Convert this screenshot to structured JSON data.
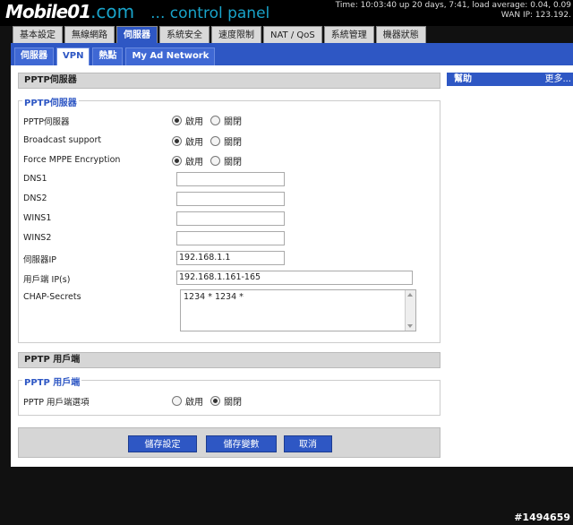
{
  "header": {
    "logo_brand": "Mobile01",
    "logo_tld": ".com",
    "logo_panel": "... control panel",
    "sysinfo_line1": "Time: 10:03:40 up 20 days, 7:41, load average: 0.04, 0.09",
    "sysinfo_line2": "WAN IP: 123.192."
  },
  "main_tabs": [
    "基本設定",
    "無線網路",
    "伺服器",
    "系統安全",
    "速度限制",
    "NAT / QoS",
    "系統管理",
    "機器狀態"
  ],
  "main_tab_active": "伺服器",
  "sub_tabs": [
    "伺服器",
    "VPN",
    "熱點",
    "My Ad Network"
  ],
  "sub_tab_active": "VPN",
  "pptp_server": {
    "section_title": "PPTP伺服器",
    "legend": "PPTP伺服器",
    "enable_label": "PPTP伺服器",
    "broadcast_label": "Broadcast support",
    "mppe_label": "Force MPPE Encryption",
    "on_label": "啟用",
    "off_label": "關閉",
    "dns1_label": "DNS1",
    "dns1_value": "",
    "dns2_label": "DNS2",
    "dns2_value": "",
    "wins1_label": "WINS1",
    "wins1_value": "",
    "wins2_label": "WINS2",
    "wins2_value": "",
    "server_ip_label": "伺服器IP",
    "server_ip_value": "192.168.1.1",
    "client_ip_label": "用戶端 IP(s)",
    "client_ip_value": "192.168.1.161-165",
    "chap_label": "CHAP-Secrets",
    "chap_value": "1234 * 1234 *"
  },
  "pptp_client": {
    "section_title": "PPTP 用戶端",
    "legend": "PPTP 用戶端",
    "option_label": "PPTP 用戶端選項",
    "on_label": "啟用",
    "off_label": "關閉"
  },
  "buttons": {
    "save": "儲存設定",
    "apply": "儲存變數",
    "cancel": "取消"
  },
  "help": {
    "title": "幫助",
    "more": "更多..."
  },
  "watermark": "#1494659",
  "colors": {
    "accent": "#2e57c4",
    "panel_gray": "#d6d6d6",
    "logo_cyan": "#19a3c9"
  }
}
